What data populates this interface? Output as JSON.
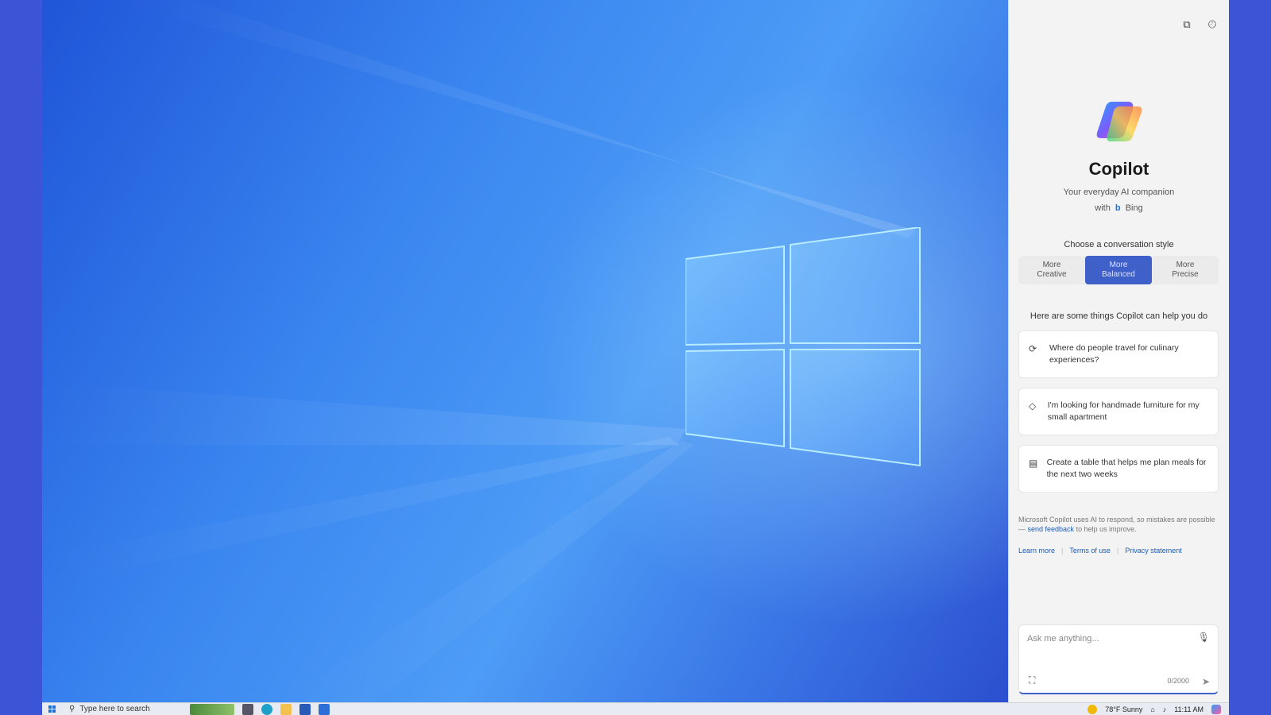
{
  "copilot": {
    "title": "Copilot",
    "subtitle": "Your everyday AI companion",
    "with_prefix": "with",
    "bing_label": "Bing",
    "choose_style": "Choose a conversation style",
    "styles": [
      {
        "line1": "More",
        "line2": "Creative",
        "active": false
      },
      {
        "line1": "More",
        "line2": "Balanced",
        "active": true
      },
      {
        "line1": "More",
        "line2": "Precise",
        "active": false
      }
    ],
    "helps_heading": "Here are some things Copilot can help you do",
    "suggestions": [
      {
        "icon": "refresh-icon",
        "text": "Where do people travel for culinary experiences?"
      },
      {
        "icon": "tag-icon",
        "text": "I'm looking for handmade furniture for my small apartment"
      },
      {
        "icon": "table-icon",
        "text": "Create a table that helps me plan meals for the next two weeks"
      }
    ],
    "disclaimer_pre": "Microsoft Copilot uses AI to respond, so mistakes are possible —",
    "disclaimer_link": "send feedback",
    "disclaimer_post": "to help us improve.",
    "links": [
      "Learn more",
      "Terms of use",
      "Privacy statement"
    ],
    "ask_placeholder": "Ask me anything...",
    "char_counter": "0/2000"
  },
  "taskbar": {
    "search_placeholder": "Type here to search",
    "weather": "78°F Sunny",
    "time": "11:11 AM"
  },
  "colors": {
    "accent": "#3f5fc9",
    "panel_bg": "#f3f3f3",
    "desktop_blue": "#3a86f0"
  }
}
